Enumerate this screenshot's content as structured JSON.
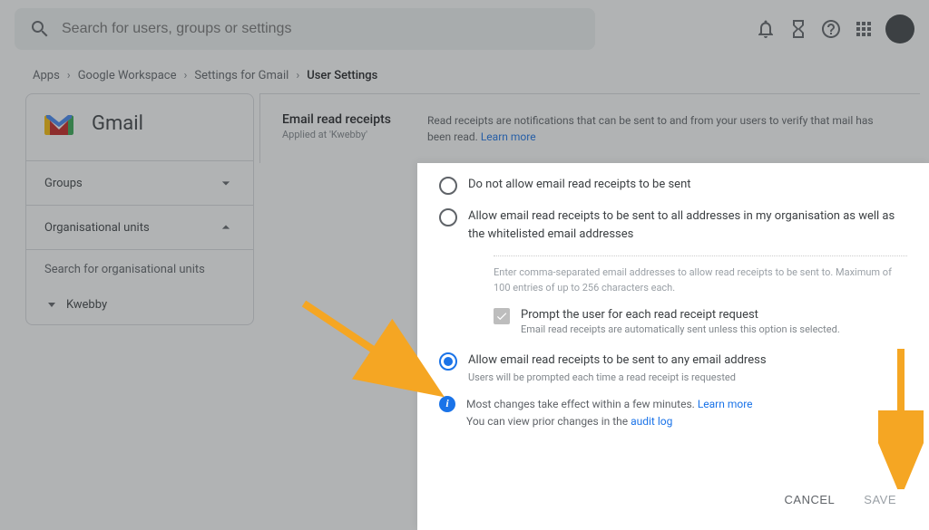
{
  "header": {
    "search_placeholder": "Search for users, groups or settings"
  },
  "breadcrumb": {
    "items": [
      "Apps",
      "Google Workspace",
      "Settings for Gmail"
    ],
    "current": "User Settings"
  },
  "sidebar": {
    "title": "Gmail",
    "groups_label": "Groups",
    "org_units_label": "Organisational units",
    "search_ou_label": "Search for organisational units",
    "org_unit_name": "Kwebby"
  },
  "settings": {
    "title": "Email read receipts",
    "applied_at": "Applied at 'Kwebby'",
    "description": "Read receipts are notifications that can be sent to and from your users to verify that mail has been read.",
    "learn_more": "Learn more"
  },
  "panel": {
    "option1": "Do not allow email read receipts to be sent",
    "option2": "Allow email read receipts to be sent to all addresses in my organisation as well as the whitelisted email addresses",
    "whitelist_helper": "Enter comma-separated email addresses to allow read receipts to be sent to. Maximum of 100 entries of up to 256 characters each.",
    "checkbox_label": "Prompt the user for each read receipt request",
    "checkbox_sub": "Email read receipts are automatically sent unless this option is selected.",
    "option3": "Allow email read receipts to be sent to any email address",
    "option3_sub": "Users will be prompted each time a read receipt is requested",
    "info_line1_a": "Most changes take effect within a few minutes.",
    "info_line1_link": "Learn more",
    "info_line2_a": "You can view prior changes in the",
    "info_line2_link": "audit log",
    "cancel": "CANCEL",
    "save": "SAVE"
  }
}
